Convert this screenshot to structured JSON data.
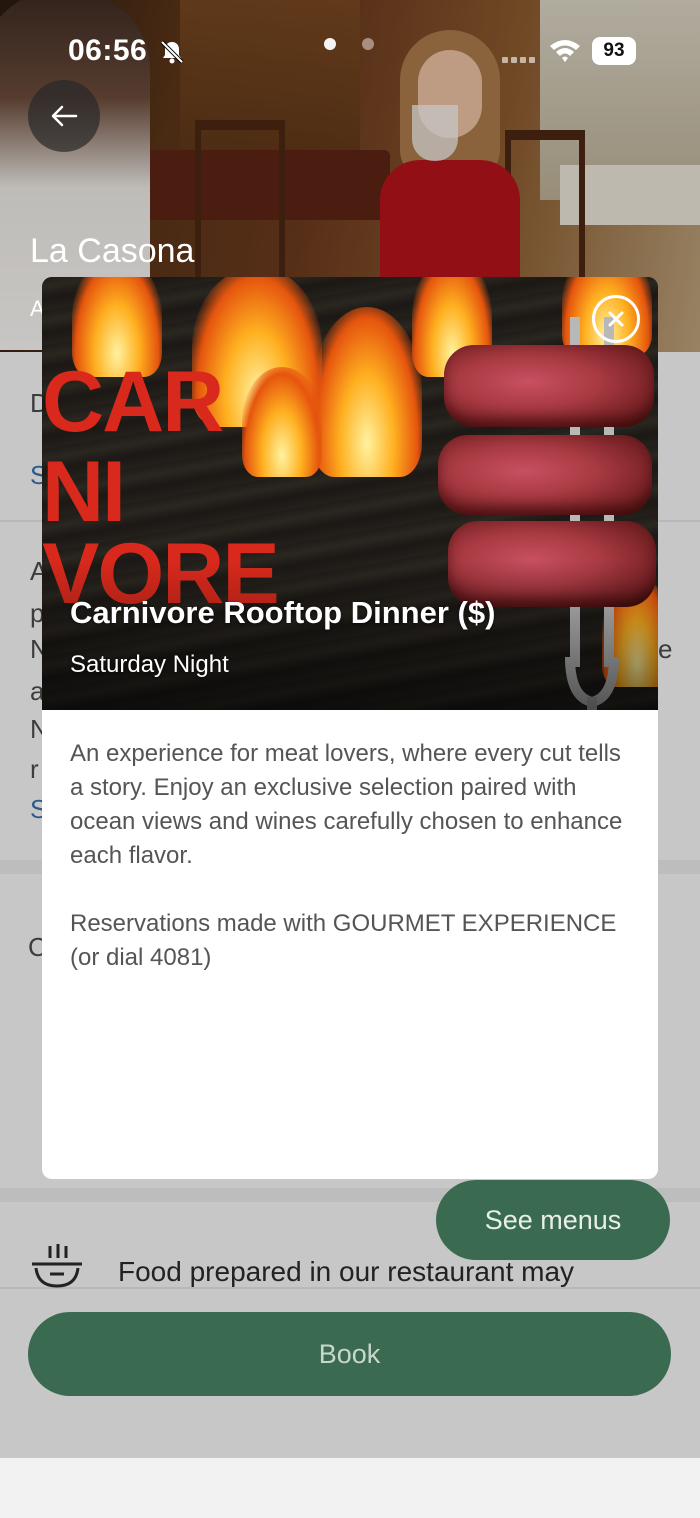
{
  "status_bar": {
    "time": "06:56",
    "battery": "93"
  },
  "restaurant": {
    "name": "La Casona",
    "subtitle_visible_letter": "A"
  },
  "background": {
    "fragments": [
      {
        "name": "bg-letter-d",
        "text": "D"
      },
      {
        "name": "bg-letter-s",
        "text": "S"
      },
      {
        "name": "bg-letter-a",
        "text": "A"
      },
      {
        "name": "bg-letter-p",
        "text": "p"
      },
      {
        "name": "bg-letter-n",
        "text": "N"
      },
      {
        "name": "bg-letter-a2",
        "text": "a"
      },
      {
        "name": "bg-letter-n2",
        "text": "N"
      },
      {
        "name": "bg-letter-r",
        "text": "r"
      },
      {
        "name": "bg-letter-s2",
        "text": "S"
      },
      {
        "name": "bg-letter-e",
        "text": "e"
      },
      {
        "name": "bg-letter-c",
        "text": "C"
      }
    ],
    "see_menus": "See menus",
    "food_note": "Food prepared in our restaurant may",
    "book": "Book"
  },
  "modal": {
    "image_word": [
      "CAR",
      "NI",
      "VORE"
    ],
    "title": "Carnivore Rooftop Dinner ($)",
    "subtitle": "Saturday Night",
    "description": "An experience for meat lovers, where every cut tells a story. Enjoy an exclusive selection paired with ocean views and wines carefully chosen to enhance each flavor.",
    "reservation": "Reservations made with GOURMET EXPERIENCE (or dial 4081)"
  },
  "colors": {
    "accent_green": "#3a6b50",
    "overlay_gray": "#c7c7c7",
    "carnivore_red": "#d8291c"
  },
  "icons": [
    "bell-off-icon",
    "signal-icon",
    "wifi-icon",
    "back-arrow-icon",
    "close-icon",
    "food-icon"
  ]
}
